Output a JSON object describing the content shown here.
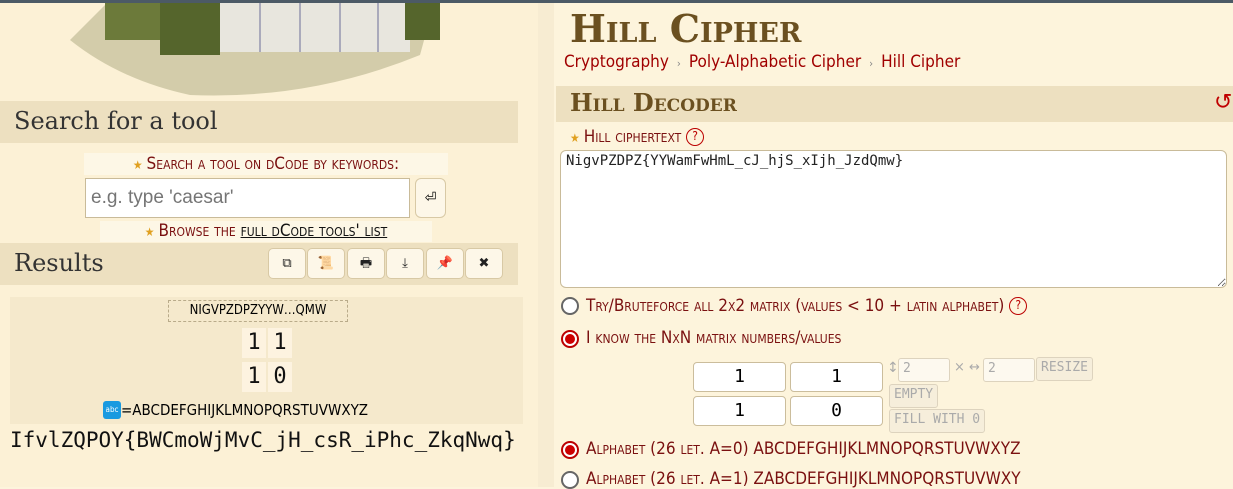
{
  "sidebar": {
    "search_heading": "Search for a tool",
    "search_label": "Search a tool on dCode by keywords:",
    "search_placeholder": "e.g. type 'caesar'",
    "enter_icon": "⏎",
    "browse_prefix": "Browse the ",
    "browse_link": "full dCode tools' list",
    "results_heading": "Results",
    "result_buttons": [
      {
        "icon": "copy-icon",
        "glyph": "⧉"
      },
      {
        "icon": "scroll-icon",
        "glyph": "📜"
      },
      {
        "icon": "print-icon",
        "glyph": "🖶"
      },
      {
        "icon": "download-icon",
        "glyph": "⤓"
      },
      {
        "icon": "pin-icon",
        "glyph": "📌"
      },
      {
        "icon": "close-icon",
        "glyph": "✖"
      }
    ],
    "result": {
      "cipher_summary": "NIGVPZDPZYYW…QMW",
      "matrix": [
        [
          "1",
          "1"
        ],
        [
          "1",
          "0"
        ]
      ],
      "alphabet_badge": "abc",
      "alphabet": "=ABCDEFGHIJKLMNOPQRSTUVWXYZ",
      "plaintext": "IfvlZQPOY{BWCmoWjMvC_jH_csR_iPhc_ZkqNwq}"
    }
  },
  "main": {
    "title": "Hill Cipher",
    "breadcrumb": [
      "Cryptography",
      "Poly-Alphabetic Cipher",
      "Hill Cipher"
    ],
    "decoder_heading": "Hill Decoder",
    "reset_icon": "↺",
    "ciphertext_label": "Hill ciphertext",
    "ciphertext_value": "NigvPZDPZ{YYWamFwHmL_cJ_hjS_xIjh_JzdQmw}",
    "option_bruteforce": "Try/Bruteforce all 2x2 matrix (values < 10 + latin alphabet)",
    "option_known": "I know the NxN matrix numbers/values",
    "matrix": [
      [
        "1",
        "1"
      ],
      [
        "1",
        "0"
      ]
    ],
    "rows": "2",
    "cols": "2",
    "resize_label": "RESIZE",
    "empty_label": "EMPTY",
    "fill_label": "FILL WITH 0",
    "alphabet_a0": "Alphabet (26 let. A=0) ABCDEFGHIJKLMNOPQRSTUVWXYZ",
    "alphabet_a1": "Alphabet (26 let. A=1) ZABCDEFGHIJKLMNOPQRSTUVWXY",
    "selected": {
      "mode": "known",
      "alphabet": "a0"
    }
  },
  "colors": {
    "title": "#6b5020",
    "accent": "#b00000",
    "band": "#ede0c0",
    "background": "#fdf4dc"
  }
}
